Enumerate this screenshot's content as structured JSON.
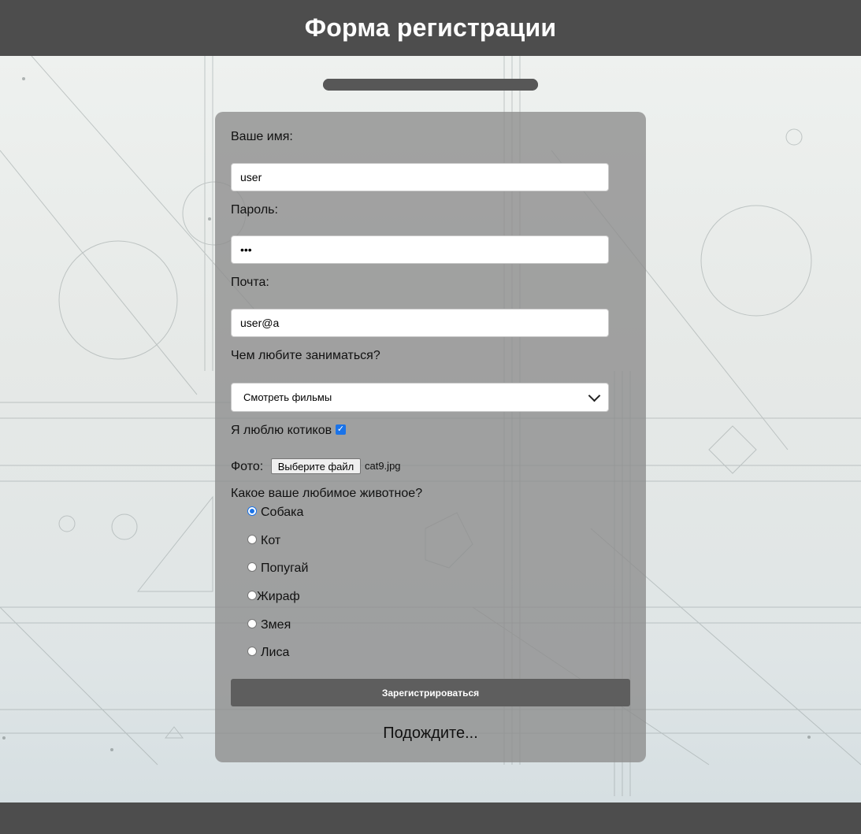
{
  "header": {
    "title": "Форма регистрации"
  },
  "progress": {
    "percent": 100
  },
  "form": {
    "name": {
      "label": "Ваше имя:",
      "value": "user"
    },
    "password": {
      "label": "Пароль:",
      "value": "•••"
    },
    "email": {
      "label": "Почта:",
      "value": "user@a"
    },
    "hobby": {
      "label": "Чем любите заниматься?",
      "selected": "Смотреть фильмы"
    },
    "cats": {
      "label": "Я люблю котиков",
      "checked": true,
      "check_glyph": "✓"
    },
    "photo": {
      "label": "Фото:",
      "button": "Выберите файл",
      "file_name": "cat9.jpg"
    },
    "animal": {
      "label": "Какое ваше любимое животное?",
      "options": [
        "Собака",
        "Кот",
        "Попугай",
        "Жираф",
        "Змея",
        "Лиса"
      ],
      "selected_index": 0
    },
    "submit_label": "Зарегистрироваться",
    "status": "Подождите..."
  },
  "colors": {
    "header": "#4d4d4d",
    "accent": "#1a73e8",
    "panel": "#8c8c8c"
  }
}
